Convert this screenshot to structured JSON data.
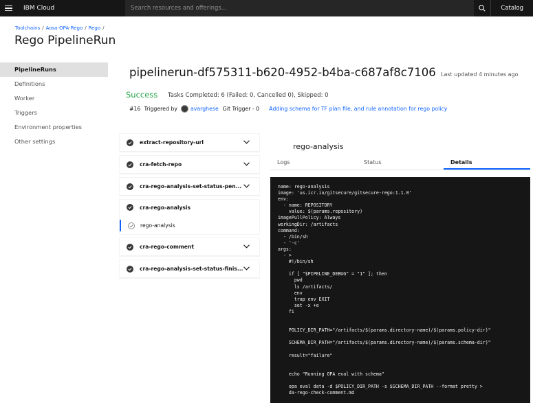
{
  "topbar": {
    "brand": "IBM Cloud",
    "search_placeholder": "Search resources and offerings...",
    "catalog_label": "Catalog"
  },
  "breadcrumb": [
    "Toolchains",
    "Aosa-OPA-Rego",
    "Rego"
  ],
  "page_title": "Rego PipelineRun",
  "sidebar": {
    "items": [
      {
        "label": "PipelineRuns",
        "active": true
      },
      {
        "label": "Definitions"
      },
      {
        "label": "Worker"
      },
      {
        "label": "Triggers"
      },
      {
        "label": "Environment properties"
      },
      {
        "label": "Other settings"
      }
    ]
  },
  "run": {
    "title": "pipelinerun-df575311-b620-4952-b4ba-c687af8c7106",
    "last_updated": "Last updated 4 minutes ago",
    "status": "Success",
    "tasks_summary": "Tasks Completed: 6 (Failed: 0, Cancelled 0), Skipped: 0",
    "number": "#16",
    "triggered_by_label": "Triggered by",
    "user": "avarghese",
    "trigger": "Git Trigger - 0",
    "commit_message": "Adding schema for TF plan file, and rule annotation for rego policy"
  },
  "tasks": [
    {
      "label": "extract-repository-url"
    },
    {
      "label": "cra-fetch-repo"
    },
    {
      "label": "cra-rego-analysis-set-status-pen..."
    },
    {
      "label": "cra-rego-analysis",
      "step": "rego-analysis"
    },
    {
      "label": "cra-rego-comment"
    },
    {
      "label": "cra-rego-analysis-set-status-finis..."
    }
  ],
  "panel": {
    "title": "rego-analysis",
    "tabs": [
      "Logs",
      "Status",
      "Details"
    ],
    "active_tab": "Details",
    "details": "name: rego-analysis\nimage: 'us.icr.io/gitsecure/gitsecure-rego:1.1.0'\nenv:\n  - name: REPOSITORY\n    value: $(params.repository)\nimagePullPolicy: Always\nworkingDir: /artifacts\ncommand:\n  - /bin/sh\n  - '-c'\nargs:\n  - >\n    #!/bin/sh\n\n    if [ \"$PIPELINE_DEBUG\" = \"1\" ]; then\n      pwd\n      ls /artifacts/\n      env\n      trap env EXIT\n      set -x +e\n    fi\n\n\n    POLICY_DIR_PATH=\"/artifacts/$(params.directory-name)/$(params.policy-dir)\"\n\n    SCHEMA_DIR_PATH=\"/artifacts/$(params.directory-name)/$(params.schema-dir)\"\n\n    result=\"failure\"\n\n\n    echo \"Running OPA eval with schema\"\n\n    opa eval data -d $POLICY_DIR_PATH -s $SCHEMA_DIR_PATH --format pretty >\n    da-rego-check-comment.md"
  },
  "colors": {
    "accent": "#0f62fe",
    "success": "#24a148",
    "topbar": "#161616"
  }
}
